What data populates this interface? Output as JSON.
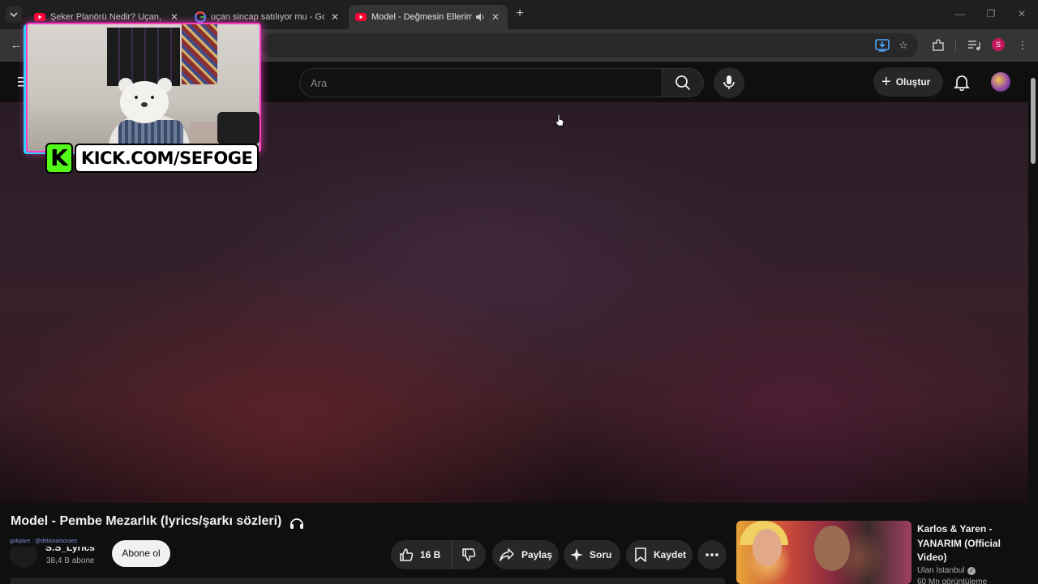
{
  "browser": {
    "tabs": [
      {
        "title": "Şeker Planörü Nedir? Uçan, Tatlı",
        "favicon": "youtube-icon",
        "active": false
      },
      {
        "title": "uçan sincap satılıyor mu - Google",
        "favicon": "google-icon",
        "active": false
      },
      {
        "title": "Model - Değmesin Ellerimiz",
        "favicon": "youtube-icon",
        "active": true,
        "audio": true
      }
    ],
    "profile_initial": "S"
  },
  "youtube": {
    "search_placeholder": "Ara",
    "create_label": "Oluştur"
  },
  "overlay": {
    "kick_letter": "K",
    "kick_url": "KICK.COM/SEFOGE",
    "ticker_text": "gokpare : @deboramoraez"
  },
  "video": {
    "title": "Model - Pembe Mezarlık (lyrics/şarkı sözleri)",
    "channel_name": "S.S_Lyrics",
    "subscriber_count": "38,4 B abone",
    "subscribe_label": "Abone ol",
    "like_count": "16 B",
    "share_label": "Paylaş",
    "ask_label": "Soru",
    "save_label": "Kaydet"
  },
  "recommendation": {
    "title": "Karlos & Yaren - YANARIM (Official Video)",
    "channel": "Ulan İstanbul",
    "meta": "60 Mn görüntüleme"
  },
  "colors": {
    "kick_green": "#53fc18",
    "webcam_border_pink": "#ff3cc8",
    "webcam_border_blue": "#2ed0ff",
    "profile_pink": "#c2185b"
  }
}
